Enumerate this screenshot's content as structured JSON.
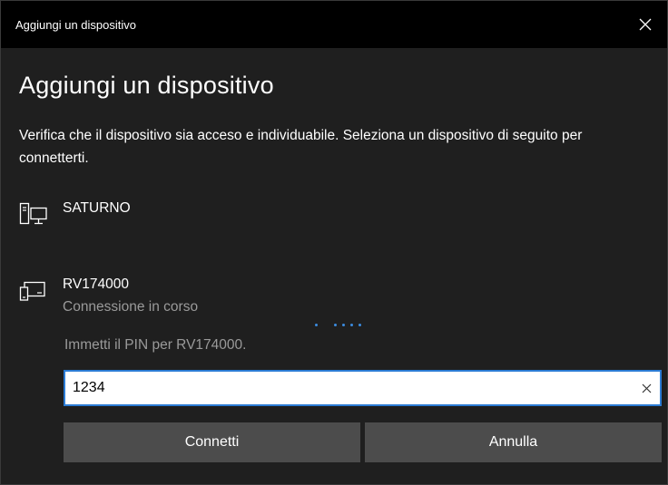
{
  "window": {
    "title": "Aggiungi un dispositivo",
    "close_icon": "close-icon"
  },
  "main": {
    "heading": "Aggiungi un dispositivo",
    "description": "Verifica che il dispositivo sia acceso e individuabile. Seleziona un dispositivo di seguito per connetterti."
  },
  "devices": [
    {
      "name": "SATURNO",
      "icon": "desktop-computer-icon"
    },
    {
      "name": "RV174000",
      "status": "Connessione in corso",
      "icon": "display-device-icon"
    }
  ],
  "pin": {
    "prompt": "Immetti il PIN per RV174000.",
    "value": "1234",
    "clear_icon": "clear-icon"
  },
  "buttons": {
    "connect": "Connetti",
    "cancel": "Annulla"
  },
  "colors": {
    "accent": "#2b7bd4",
    "progress_dots": "#3b8ce0",
    "button_bg": "#4c4c4c",
    "titlebar_bg": "#000000",
    "window_bg": "#1f1f1f",
    "secondary_text": "#9a9a9a"
  }
}
